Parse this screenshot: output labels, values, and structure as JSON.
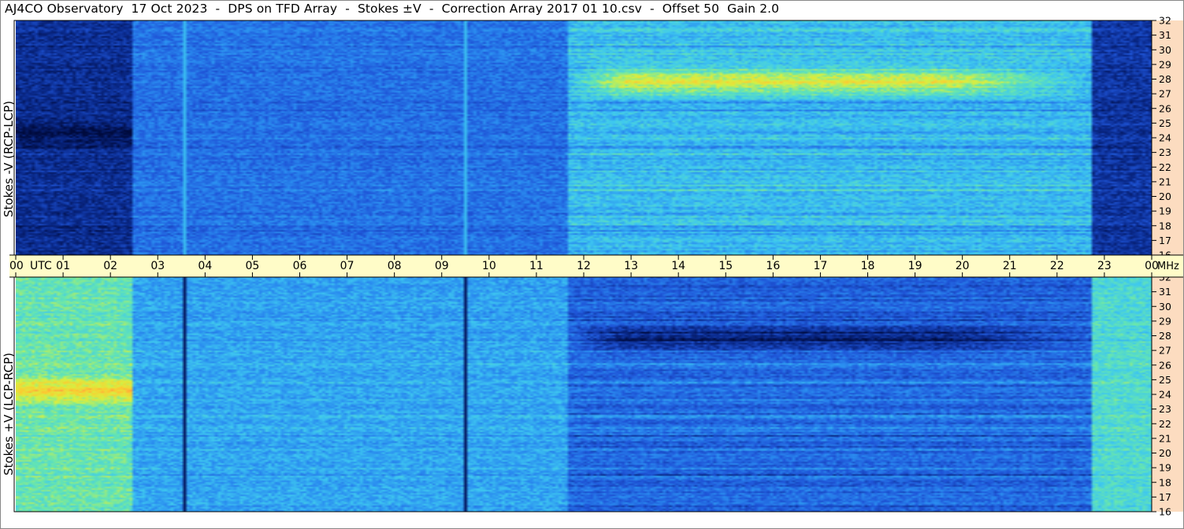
{
  "title": "AJ4CO Observatory  17 Oct 2023  -  DPS on TFD Array  -  Stokes ±V  -  Correction Array 2017 01 10.csv  -  Offset 50  Gain 2.0",
  "chart_data": [
    {
      "type": "heatmap",
      "ylabel": "Stokes -V (RCP-LCP)",
      "y_unit": "MHz",
      "ylim": [
        16,
        32
      ],
      "y_ticks": [
        "16",
        "17",
        "18",
        "19",
        "20",
        "21",
        "22",
        "23",
        "24",
        "25",
        "26",
        "27",
        "28",
        "29",
        "30",
        "31",
        "32"
      ],
      "x_ticks": [
        "00",
        "01",
        "02",
        "03",
        "04",
        "05",
        "06",
        "07",
        "08",
        "09",
        "10",
        "11",
        "12",
        "13",
        "14",
        "15",
        "16",
        "17",
        "18",
        "19",
        "20",
        "21",
        "22",
        "23",
        "00"
      ],
      "x_unit": "UTC",
      "xlim": [
        0,
        24
      ],
      "colormap": [
        "#000a3c",
        "#0a2a8c",
        "#1f55d8",
        "#2a8cf0",
        "#3ec8f0",
        "#66e6b0",
        "#d8f040",
        "#ffc830",
        "#ff5060",
        "#ff78d0"
      ],
      "regions": [
        {
          "from_utc": 0,
          "to_utc": 2.45,
          "level": 0.12,
          "peak_mhz": 24.3,
          "peak_level": 0.02
        },
        {
          "from_utc": 2.45,
          "to_utc": 11.65,
          "level": 0.28
        },
        {
          "from_utc": 11.65,
          "to_utc": 22.75,
          "level": 0.42,
          "active_band_mhz": [
            26.5,
            29.2
          ],
          "active_level": 0.7
        },
        {
          "from_utc": 22.75,
          "to_utc": 24,
          "level": 0.14
        }
      ],
      "vertical_lines_utc": [
        3.55,
        9.5
      ]
    },
    {
      "type": "heatmap",
      "ylabel": "Stokes +V (LCP-RCP)",
      "y_unit": "MHz",
      "ylim": [
        16,
        32
      ],
      "y_ticks": [
        "16",
        "17",
        "18",
        "19",
        "20",
        "21",
        "22",
        "23",
        "24",
        "25",
        "26",
        "27",
        "28",
        "29",
        "30",
        "31",
        "32"
      ],
      "x_ticks": [
        "00",
        "01",
        "02",
        "03",
        "04",
        "05",
        "06",
        "07",
        "08",
        "09",
        "10",
        "11",
        "12",
        "13",
        "14",
        "15",
        "16",
        "17",
        "18",
        "19",
        "20",
        "21",
        "22",
        "23",
        "00"
      ],
      "x_unit": "UTC",
      "xlim": [
        0,
        24
      ],
      "colormap": [
        "#000a3c",
        "#0a2a8c",
        "#1f55d8",
        "#2a8cf0",
        "#3ec8f0",
        "#66e6b0",
        "#d8f040",
        "#ffc830",
        "#ff5060",
        "#ff78d0"
      ],
      "regions": [
        {
          "from_utc": 0,
          "to_utc": 2.45,
          "level": 0.55,
          "peak_mhz": 24.3,
          "peak_level": 0.75
        },
        {
          "from_utc": 2.45,
          "to_utc": 11.65,
          "level": 0.38
        },
        {
          "from_utc": 11.65,
          "to_utc": 22.75,
          "level": 0.26,
          "active_band_mhz": [
            26.5,
            29.2
          ],
          "active_level": 0.08
        },
        {
          "from_utc": 22.75,
          "to_utc": 24,
          "level": 0.5
        }
      ],
      "vertical_lines_utc": [
        3.55,
        9.5
      ]
    }
  ],
  "colors": {
    "axis_band": "#fffcc8",
    "right_axis": "#fcdcc0",
    "frame": "#000000"
  }
}
